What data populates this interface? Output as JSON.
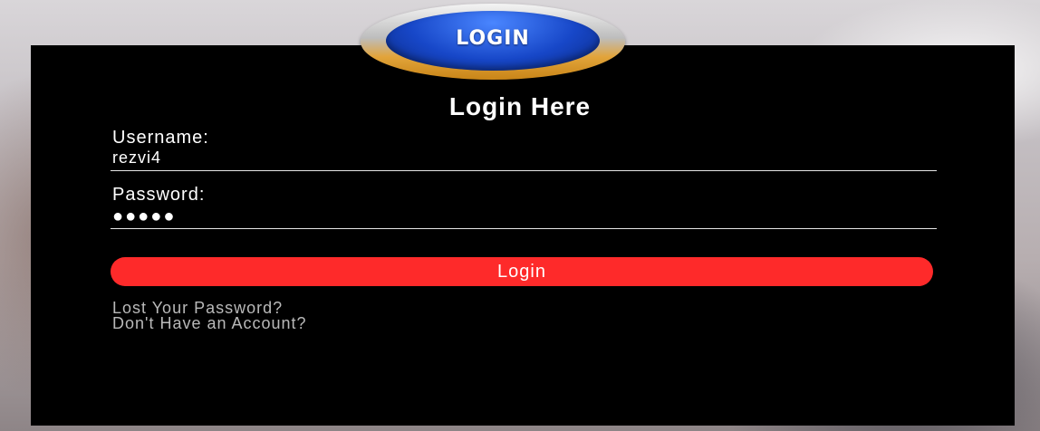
{
  "login_badge": {
    "text": "LOGIN"
  },
  "form": {
    "title": "Login Here",
    "username_label": "Username:",
    "username_value": "rezvi4",
    "password_label": "Password:",
    "password_mask": "●●●●●",
    "submit_label": "Login"
  },
  "links": {
    "lost_password": "Lost Your Password?",
    "no_account": "Don't Have an Account?"
  },
  "colors": {
    "panel": "#000000",
    "button": "#fe2a2a",
    "badge_blue": "#1747c8",
    "badge_ring": "#e2a43a"
  }
}
